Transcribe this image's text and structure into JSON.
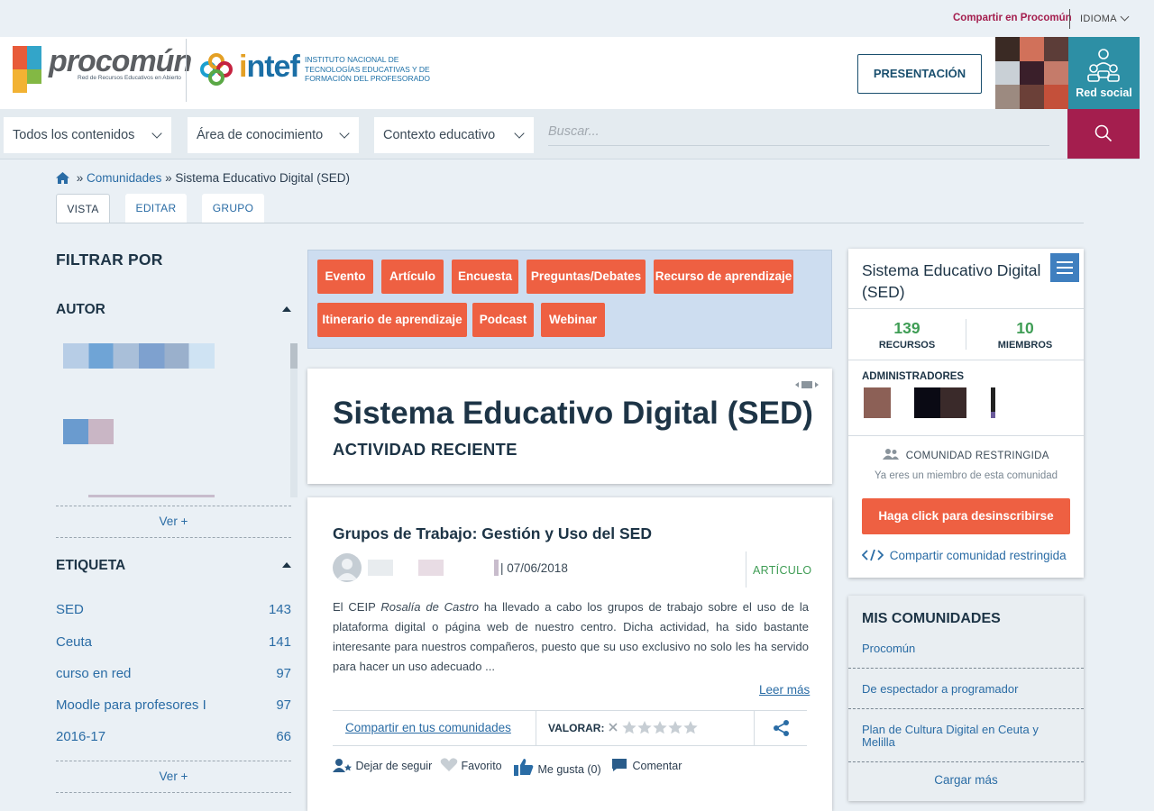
{
  "topbar": {
    "share_link": "Compartir en Procomún",
    "language": "IDIOMA"
  },
  "header": {
    "brand": "procomún",
    "brand_sub": "Red de Recursos Educativos en Abierto",
    "intef_word_i": "i",
    "intef_word_rest": "ntef",
    "intef_text": "INSTITUTO NACIONAL DE TECNOLOGÍAS EDUCATIVAS Y DE FORMACIÓN DEL PROFESORADO",
    "presentation_button": "PRESENTACIÓN",
    "red_social": "Red social"
  },
  "search": {
    "select_contents": "Todos los contenidos",
    "select_area": "Área de conocimiento",
    "select_context": "Contexto educativo",
    "placeholder": "Buscar..."
  },
  "breadcrumb": {
    "sep1": "»",
    "link": "Comunidades",
    "sep2": "»",
    "current": "Sistema Educativo Digital (SED)"
  },
  "tabs": [
    "VISTA",
    "EDITAR",
    "GRUPO"
  ],
  "filters": {
    "title": "FILTRAR POR",
    "author": {
      "title": "AUTOR",
      "more": "Ver +"
    },
    "tags": {
      "title": "ETIQUETA",
      "items": [
        {
          "label": "SED",
          "count": "143"
        },
        {
          "label": "Ceuta",
          "count": "141"
        },
        {
          "label": "curso en red",
          "count": "97"
        },
        {
          "label": "Moodle para profesores I",
          "count": "97"
        },
        {
          "label": "2016-17",
          "count": "66"
        }
      ],
      "more": "Ver +"
    }
  },
  "types": [
    "Evento",
    "Artículo",
    "Encuesta",
    "Preguntas/Debates",
    "Recurso de aprendizaje",
    "Itinerario de aprendizaje",
    "Podcast",
    "Webinar"
  ],
  "community_card": {
    "title": "Sistema Educativo Digital (SED)",
    "subtitle": "ACTIVIDAD RECIENTE"
  },
  "post": {
    "title": "Grupos de Trabajo: Gestión y Uso del SED",
    "date": "| 07/06/2018",
    "type": "ARTÍCULO",
    "body_1": "El CEIP ",
    "body_em": "Rosalía de Castro",
    "body_2": " ha llevado a cabo los grupos de trabajo sobre el uso de la plataforma digital o página web de nuestro centro. Dicha actividad, ha sido bastante interesante para nuestros compañeros, puesto que su uso exclusivo no solo les ha servido para hacer un uso adecuado ...",
    "read_more": "Leer más",
    "share": "Compartir en tus comunidades",
    "rate_label": "VALORAR:",
    "rating": 0,
    "unfollow": "Dejar de seguir",
    "favorite": "Favorito",
    "like": "Me gusta (0)",
    "comment": "Comentar"
  },
  "sidebar": {
    "title": "Sistema Educativo Digital (SED)",
    "resources_count": "139",
    "resources_label": "RECURSOS",
    "members_count": "10",
    "members_label": "MIEMBROS",
    "admins_label": "ADMINISTRADORES",
    "restricted": "COMUNIDAD RESTRINGIDA",
    "member_note": "Ya eres un miembro de esta comunidad",
    "unsubscribe": "Haga click para desinscribirse",
    "share_restricted": "Compartir comunidad restringida"
  },
  "my_communities": {
    "title": "MIS COMUNIDADES",
    "items": [
      "Procomún",
      "De espectador a programador",
      "Plan de Cultura Digital en Ceuta y Melilla"
    ],
    "load_more": "Cargar más"
  },
  "colors": {
    "accent_red": "#a41e4e",
    "orange": "#ee6042",
    "teal": "#2d8fa5",
    "link_blue": "#2a6ca5",
    "green": "#3f9d55"
  }
}
